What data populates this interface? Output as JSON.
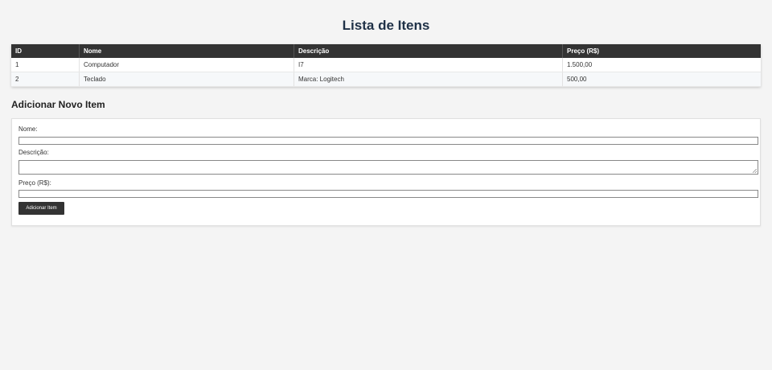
{
  "page": {
    "title": "Lista de Itens"
  },
  "table": {
    "headers": [
      "ID",
      "Nome",
      "Descrição",
      "Preço (R$)"
    ],
    "rows": [
      [
        "1",
        "Computador",
        "I7",
        "1.500,00"
      ],
      [
        "2",
        "Teclado",
        "Marca: Logitech",
        "500,00"
      ]
    ]
  },
  "form": {
    "title": "Adicionar Novo Item",
    "nome_label": "Nome:",
    "nome_value": "",
    "descricao_label": "Descrição:",
    "descricao_value": "",
    "preco_label": "Preço (R$):",
    "preco_value": "",
    "submit_label": "Adicionar Item"
  },
  "colors": {
    "header_bg": "#333333",
    "title_color": "#1f3147",
    "page_bg": "#f4f4f4"
  }
}
